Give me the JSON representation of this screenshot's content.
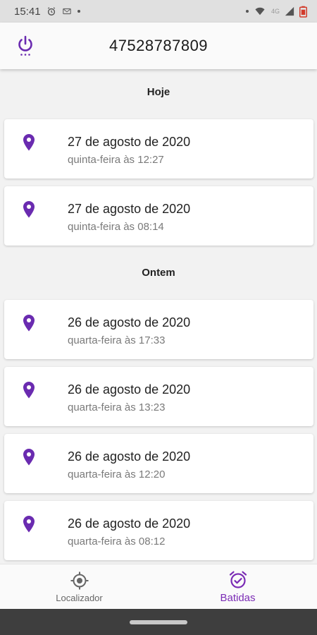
{
  "status_bar": {
    "time": "15:41",
    "network": "4G"
  },
  "app_bar": {
    "title": "47528787809"
  },
  "sections": [
    {
      "title": "Hoje",
      "entries": [
        {
          "date": "27 de agosto de 2020",
          "time": "quinta-feira às 12:27"
        },
        {
          "date": "27 de agosto de 2020",
          "time": "quinta-feira às 08:14"
        }
      ]
    },
    {
      "title": "Ontem",
      "entries": [
        {
          "date": "26 de agosto de 2020",
          "time": "quarta-feira às 17:33"
        },
        {
          "date": "26 de agosto de 2020",
          "time": "quarta-feira às 13:23"
        },
        {
          "date": "26 de agosto de 2020",
          "time": "quarta-feira às 12:20"
        },
        {
          "date": "26 de agosto de 2020",
          "time": "quarta-feira às 08:12"
        }
      ]
    }
  ],
  "bottom_nav": {
    "items": [
      {
        "label": "Localizador",
        "icon": "crosshair-icon",
        "active": false
      },
      {
        "label": "Batidas",
        "icon": "alarm-check-icon",
        "active": true
      }
    ]
  },
  "colors": {
    "accent": "#6a2bb0",
    "active_label": "#7b2cb5"
  }
}
